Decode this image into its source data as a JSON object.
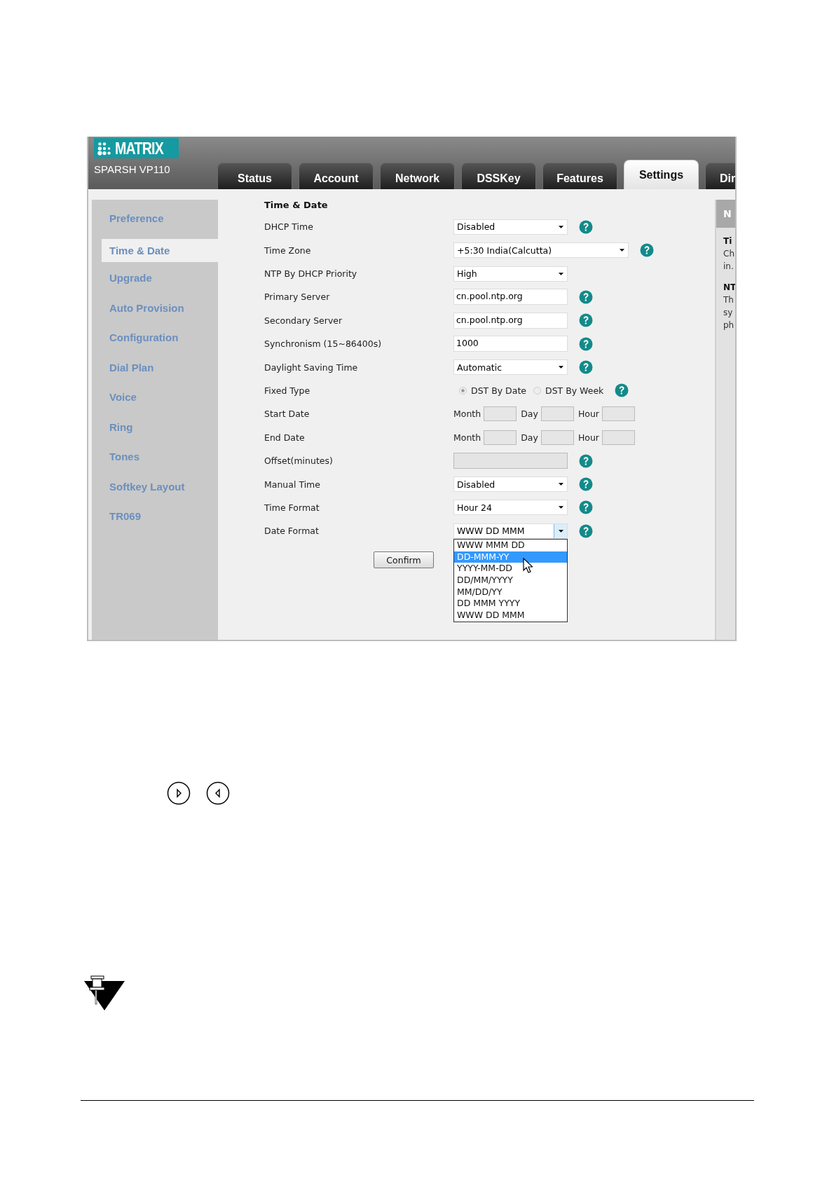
{
  "logo": {
    "brand": "MATRIX",
    "model": "SPARSH VP110"
  },
  "tabs": [
    {
      "label": "Status",
      "selected": false
    },
    {
      "label": "Account",
      "selected": false
    },
    {
      "label": "Network",
      "selected": false
    },
    {
      "label": "DSSKey",
      "selected": false
    },
    {
      "label": "Features",
      "selected": false
    },
    {
      "label": "Settings",
      "selected": true
    },
    {
      "label": "Dir",
      "selected": false
    }
  ],
  "sidebar": {
    "items": [
      {
        "label": "Preference",
        "selected": false
      },
      {
        "label": "Time & Date",
        "selected": true
      },
      {
        "label": "Upgrade",
        "selected": false
      },
      {
        "label": "Auto Provision",
        "selected": false
      },
      {
        "label": "Configuration",
        "selected": false
      },
      {
        "label": "Dial Plan",
        "selected": false
      },
      {
        "label": "Voice",
        "selected": false
      },
      {
        "label": "Ring",
        "selected": false
      },
      {
        "label": "Tones",
        "selected": false
      },
      {
        "label": "Softkey Layout",
        "selected": false
      },
      {
        "label": "TR069",
        "selected": false
      }
    ]
  },
  "form": {
    "title": "Time & Date",
    "rows": [
      {
        "label": "DHCP Time",
        "kind": "select",
        "value": "Disabled",
        "help": true
      },
      {
        "label": "Time Zone",
        "kind": "select",
        "value": "+5:30 India(Calcutta)",
        "help": true
      },
      {
        "label": "NTP By DHCP Priority",
        "kind": "select",
        "value": "High",
        "help": false
      },
      {
        "label": "Primary Server",
        "kind": "text",
        "value": "cn.pool.ntp.org",
        "disabled": false,
        "help": true
      },
      {
        "label": "Secondary Server",
        "kind": "text",
        "value": "cn.pool.ntp.org",
        "disabled": false,
        "help": true
      },
      {
        "label": "Synchronism (15~86400s)",
        "kind": "text",
        "value": "1000",
        "disabled": false,
        "help": true
      },
      {
        "label": "Daylight Saving Time",
        "kind": "select",
        "value": "Automatic",
        "help": true
      },
      {
        "label": "Fixed Type",
        "kind": "radio",
        "options": [
          {
            "label": "DST By Date",
            "selected": true
          },
          {
            "label": "DST By Week",
            "selected": false
          }
        ],
        "help": true
      },
      {
        "label": "Start Date",
        "kind": "parts",
        "parts": [
          "Month",
          "Day",
          "Hour"
        ],
        "help": false
      },
      {
        "label": "End Date",
        "kind": "parts",
        "parts": [
          "Month",
          "Day",
          "Hour"
        ],
        "help": false
      },
      {
        "label": "Offset(minutes)",
        "kind": "text",
        "disabled": true,
        "help": true
      },
      {
        "label": "Manual Time",
        "kind": "select",
        "value": "Disabled",
        "help": true
      },
      {
        "label": "Time Format",
        "kind": "select",
        "value": "Hour 24",
        "help": true
      },
      {
        "label": "Date Format",
        "kind": "select",
        "value": "WWW DD MMM",
        "open": true,
        "help": true
      }
    ]
  },
  "confirm_button": "Confirm",
  "dropdown": {
    "options": [
      {
        "label": "WWW MMM DD",
        "selected": false
      },
      {
        "label": "DD-MMM-YY",
        "selected": true
      },
      {
        "label": "YYYY-MM-DD",
        "selected": false
      },
      {
        "label": "DD/MM/YYYY",
        "selected": false
      },
      {
        "label": "MM/DD/YY",
        "selected": false
      },
      {
        "label": "DD MMM YYYY",
        "selected": false
      },
      {
        "label": "WWW DD MMM",
        "selected": false
      }
    ]
  },
  "side_panel": {
    "header": "N",
    "lines": [
      {
        "kind": "heading",
        "text": "Ti"
      },
      {
        "kind": "text",
        "text": "Ch"
      },
      {
        "kind": "text",
        "text": "in."
      },
      {
        "kind": "heading",
        "text": "NT"
      },
      {
        "kind": "text",
        "text": "Th"
      },
      {
        "kind": "text",
        "text": "sy"
      },
      {
        "kind": "text",
        "text": "ph"
      }
    ]
  }
}
